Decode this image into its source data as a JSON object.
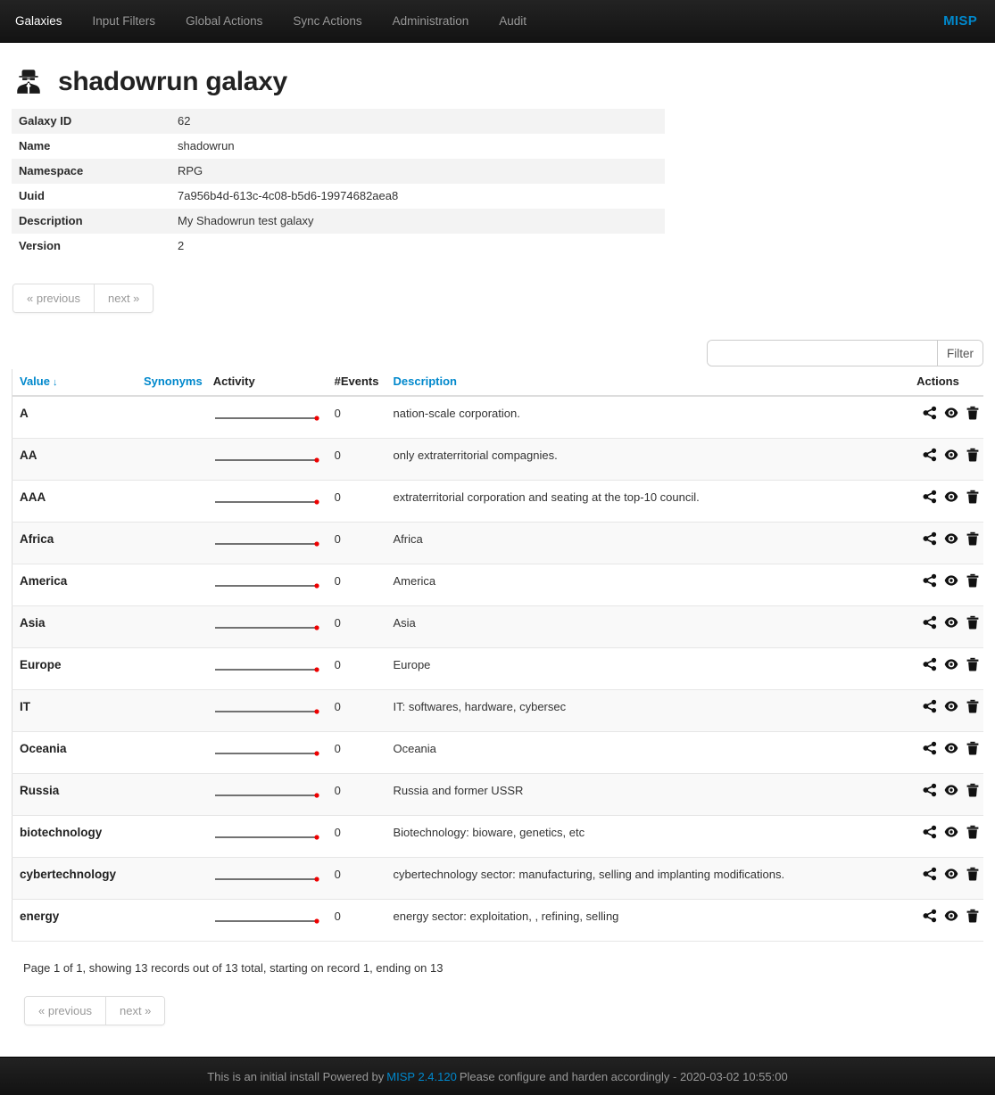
{
  "navbar": {
    "items": [
      {
        "label": "Galaxies"
      },
      {
        "label": "Input Filters"
      },
      {
        "label": "Global Actions"
      },
      {
        "label": "Sync Actions"
      },
      {
        "label": "Administration"
      },
      {
        "label": "Audit"
      }
    ],
    "brand": "MISP",
    "brand_color": "#0088cc"
  },
  "header": {
    "icon": "user-secret-icon",
    "title": "shadowrun galaxy"
  },
  "details": [
    {
      "key": "Galaxy ID",
      "value": "62"
    },
    {
      "key": "Name",
      "value": "shadowrun"
    },
    {
      "key": "Namespace",
      "value": "RPG"
    },
    {
      "key": "Uuid",
      "value": "7a956b4d-613c-4c08-b5d6-19974682aea8"
    },
    {
      "key": "Description",
      "value": "My Shadowrun test galaxy"
    },
    {
      "key": "Version",
      "value": "2"
    }
  ],
  "pager": {
    "previous": "« previous",
    "next": "next »"
  },
  "filter": {
    "value": "",
    "placeholder": "",
    "button": "Filter"
  },
  "table": {
    "columns": [
      {
        "label": "Value",
        "link": true,
        "sort": "↓"
      },
      {
        "label": "Synonyms",
        "link": true,
        "sort": ""
      },
      {
        "label": "Activity",
        "link": false,
        "sort": ""
      },
      {
        "label": "#Events",
        "link": false,
        "sort": ""
      },
      {
        "label": "Description",
        "link": true,
        "sort": ""
      },
      {
        "label": "Actions",
        "link": false,
        "sort": ""
      }
    ],
    "action_icons": [
      "share-icon",
      "eye-icon",
      "trash-icon"
    ],
    "sparkline_color": "#444444",
    "sparkline_dot_color": "#ee0000",
    "rows": [
      {
        "value": "A",
        "synonyms": "",
        "events": "0",
        "description": "nation-scale corporation."
      },
      {
        "value": "AA",
        "synonyms": "",
        "events": "0",
        "description": "only extraterritorial compagnies."
      },
      {
        "value": "AAA",
        "synonyms": "",
        "events": "0",
        "description": "extraterritorial corporation and seating at the top-10 council."
      },
      {
        "value": "Africa",
        "synonyms": "",
        "events": "0",
        "description": "Africa"
      },
      {
        "value": "America",
        "synonyms": "",
        "events": "0",
        "description": "America"
      },
      {
        "value": "Asia",
        "synonyms": "",
        "events": "0",
        "description": "Asia"
      },
      {
        "value": "Europe",
        "synonyms": "",
        "events": "0",
        "description": "Europe"
      },
      {
        "value": "IT",
        "synonyms": "",
        "events": "0",
        "description": "IT: softwares, hardware, cybersec"
      },
      {
        "value": "Oceania",
        "synonyms": "",
        "events": "0",
        "description": "Oceania"
      },
      {
        "value": "Russia",
        "synonyms": "",
        "events": "0",
        "description": "Russia and former USSR"
      },
      {
        "value": "biotechnology",
        "synonyms": "",
        "events": "0",
        "description": "Biotechnology: bioware, genetics, etc"
      },
      {
        "value": "cybertechnology",
        "synonyms": "",
        "events": "0",
        "description": "cybertechnology sector: manufacturing, selling and implanting modifications."
      },
      {
        "value": "energy",
        "synonyms": "",
        "events": "0",
        "description": "energy sector: exploitation, , refining, selling"
      }
    ]
  },
  "counter": "Page 1 of 1, showing 13 records out of 13 total, starting on record 1, ending on 13",
  "footer": {
    "prefix": "This is an initial install Powered by",
    "link": "MISP 2.4.120",
    "suffix": "Please configure and harden accordingly - 2020-03-02 10:55:00"
  }
}
